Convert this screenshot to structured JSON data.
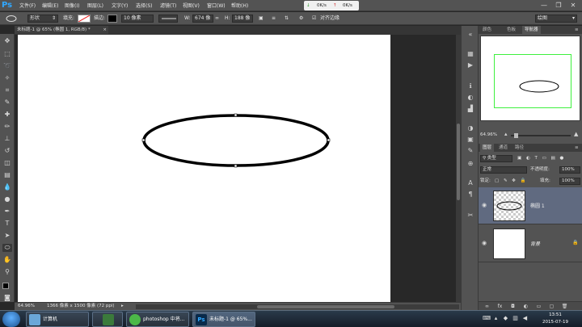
{
  "app": {
    "logo": "Ps"
  },
  "menu": [
    "文件(F)",
    "编辑(E)",
    "图像(I)",
    "图层(L)",
    "文字(Y)",
    "选择(S)",
    "滤镜(T)",
    "视图(V)",
    "窗口(W)",
    "帮助(H)"
  ],
  "net_meter": {
    "down": "0K/s",
    "up": "0K/s"
  },
  "window_controls": {
    "minimize": "—",
    "restore": "❐",
    "close": "✕"
  },
  "options": {
    "tool_mode": "形状",
    "fill_label": "填充:",
    "stroke_label": "描边:",
    "stroke_width": "10 像素",
    "w_label": "W:",
    "w_value": "674 像",
    "h_label": "H:",
    "h_value": "188 像",
    "align_edges": "对齐边缘",
    "workspace": "绘图",
    "colors": {
      "stroke_swatch": "#000000"
    }
  },
  "document": {
    "tab_title": "未标题-1 @ 65% (椭圆 1, RGB/8) *"
  },
  "canvas": {
    "shape_name": "ellipse",
    "stroke_color": "#000000"
  },
  "status": {
    "zoom": "64.96%",
    "doc_info": "1366 像素 x 1500 像素 (72 ppi)"
  },
  "panels": {
    "top_tabs": [
      "颜色",
      "色板",
      "导航器"
    ],
    "active_top_tab": "导航器",
    "navigator_zoom": "64.96%",
    "layer_tabs": [
      "图层",
      "通道",
      "路径"
    ],
    "filter_kind": "类型",
    "blend_mode": "正常",
    "opacity_label": "不透明度:",
    "opacity": "100%",
    "lock_label": "锁定:",
    "fill_label": "填充:",
    "fill": "100%",
    "layers": [
      {
        "name": "椭圆 1",
        "selected": true
      },
      {
        "name": "背景",
        "selected": false
      }
    ]
  },
  "taskbar": {
    "items": [
      {
        "label": "计算机",
        "icon": "computer-icon"
      },
      {
        "label": "",
        "icon": "terminal-icon"
      },
      {
        "label": "photoshop 中将...",
        "icon": "browser-icon"
      },
      {
        "label": "未标题-1 @ 65%...",
        "icon": "photoshop-icon"
      }
    ],
    "time": "13:51",
    "date": "2015-07-19"
  }
}
